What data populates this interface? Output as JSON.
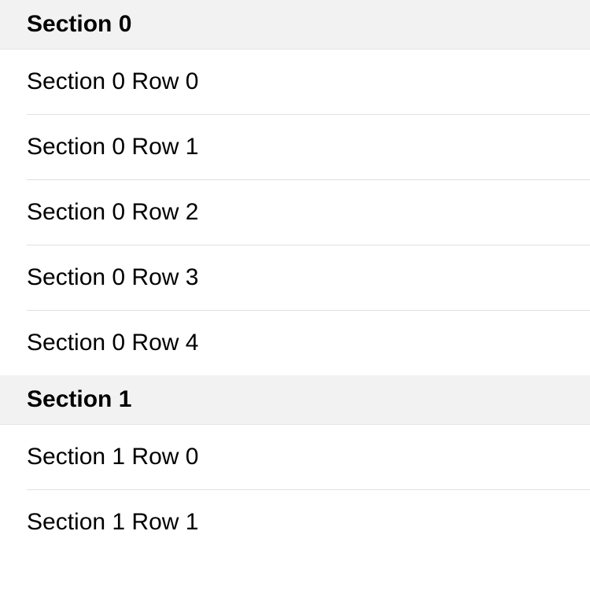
{
  "sections": [
    {
      "title": "Section 0",
      "rows": [
        {
          "label": "Section 0 Row 0"
        },
        {
          "label": "Section 0 Row 1"
        },
        {
          "label": "Section 0 Row 2"
        },
        {
          "label": "Section 0 Row 3"
        },
        {
          "label": "Section 0 Row 4"
        }
      ]
    },
    {
      "title": "Section 1",
      "rows": [
        {
          "label": "Section 1 Row 0"
        },
        {
          "label": "Section 1 Row 1"
        }
      ]
    }
  ]
}
